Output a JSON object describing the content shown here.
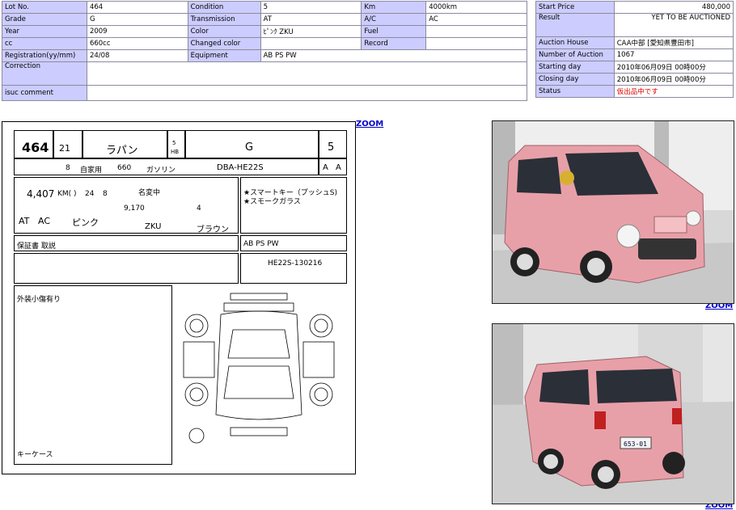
{
  "lot_table": {
    "rows": [
      [
        {
          "label": "Lot No.",
          "value": "464"
        },
        {
          "label": "Condition",
          "value": "5"
        },
        {
          "label": "Km",
          "value": "4000km"
        }
      ],
      [
        {
          "label": "Grade",
          "value": "G"
        },
        {
          "label": "Transmission",
          "value": "AT"
        },
        {
          "label": "A/C",
          "value": "AC"
        }
      ],
      [
        {
          "label": "Year",
          "value": "2009"
        },
        {
          "label": "Color",
          "value": "ﾋﾟﾝｸ ZKU"
        },
        {
          "label": "Fuel",
          "value": ""
        }
      ],
      [
        {
          "label": "cc",
          "value": "660cc"
        },
        {
          "label": "Changed color",
          "value": ""
        },
        {
          "label": "Record",
          "value": ""
        }
      ],
      [
        {
          "label": "Registration(yy/mm)",
          "value": "24/08"
        },
        {
          "label": "Equipment",
          "value": "AB PS PW"
        }
      ]
    ],
    "correction_label": "Correction",
    "correction_value": "",
    "isuc_label": "isuc comment",
    "isuc_value": ""
  },
  "price_table": {
    "start_price_label": "Start Price",
    "start_price_value": "480,000",
    "result_label": "Result",
    "result_value": "YET TO BE AUCTIONED",
    "auction_house_label": "Auction House",
    "auction_house_value": "CAA中部 [愛知県豊田市]",
    "number_label": "Number of Auction",
    "number_value": "1067",
    "starting_day_label": "Starting day",
    "starting_day_value": "2010年06月09日 00時00分",
    "closing_day_label": "Closing day",
    "closing_day_value": "2010年06月09日 00時00分",
    "status_label": "Status",
    "status_value": "仮出品中です"
  },
  "zoom_label": "ZOOM",
  "sheet": {
    "lot": "464",
    "year": "21",
    "name": "ラパン",
    "doors": "5",
    "body": "HB",
    "grade": "G",
    "score": "5",
    "seats": "8",
    "use": "自家用",
    "cc": "660",
    "fuel": "ガソリン",
    "model": "DBA-HE22S",
    "ext": "A",
    "int": "A",
    "km": "4,407",
    "km_unit": "KM(  )",
    "inspection": "24",
    "inspection_month": "8",
    "name_change": "名変中",
    "tax": "9,170",
    "capacity": "4",
    "trans": "AT",
    "ac": "AC",
    "color": "ピンク",
    "color_code": "ZKU",
    "interior": "ブラウン",
    "points_1": "★スマートキー（プッシュS)",
    "points_2": "★スモークガラス",
    "docs": "保証書 取説",
    "equipment": "AB PS PW",
    "chassis": "HE22S-130216",
    "inspector_note": "外装小傷有り",
    "accessories": "キーケース"
  },
  "photos": {
    "front_plate": "",
    "rear_plate": "653-01"
  },
  "colors": {
    "label_bg": "#ccccff",
    "status_red": "#e00000",
    "car_pink": "#e8a0a8",
    "zoom_blue": "#0000cc"
  }
}
